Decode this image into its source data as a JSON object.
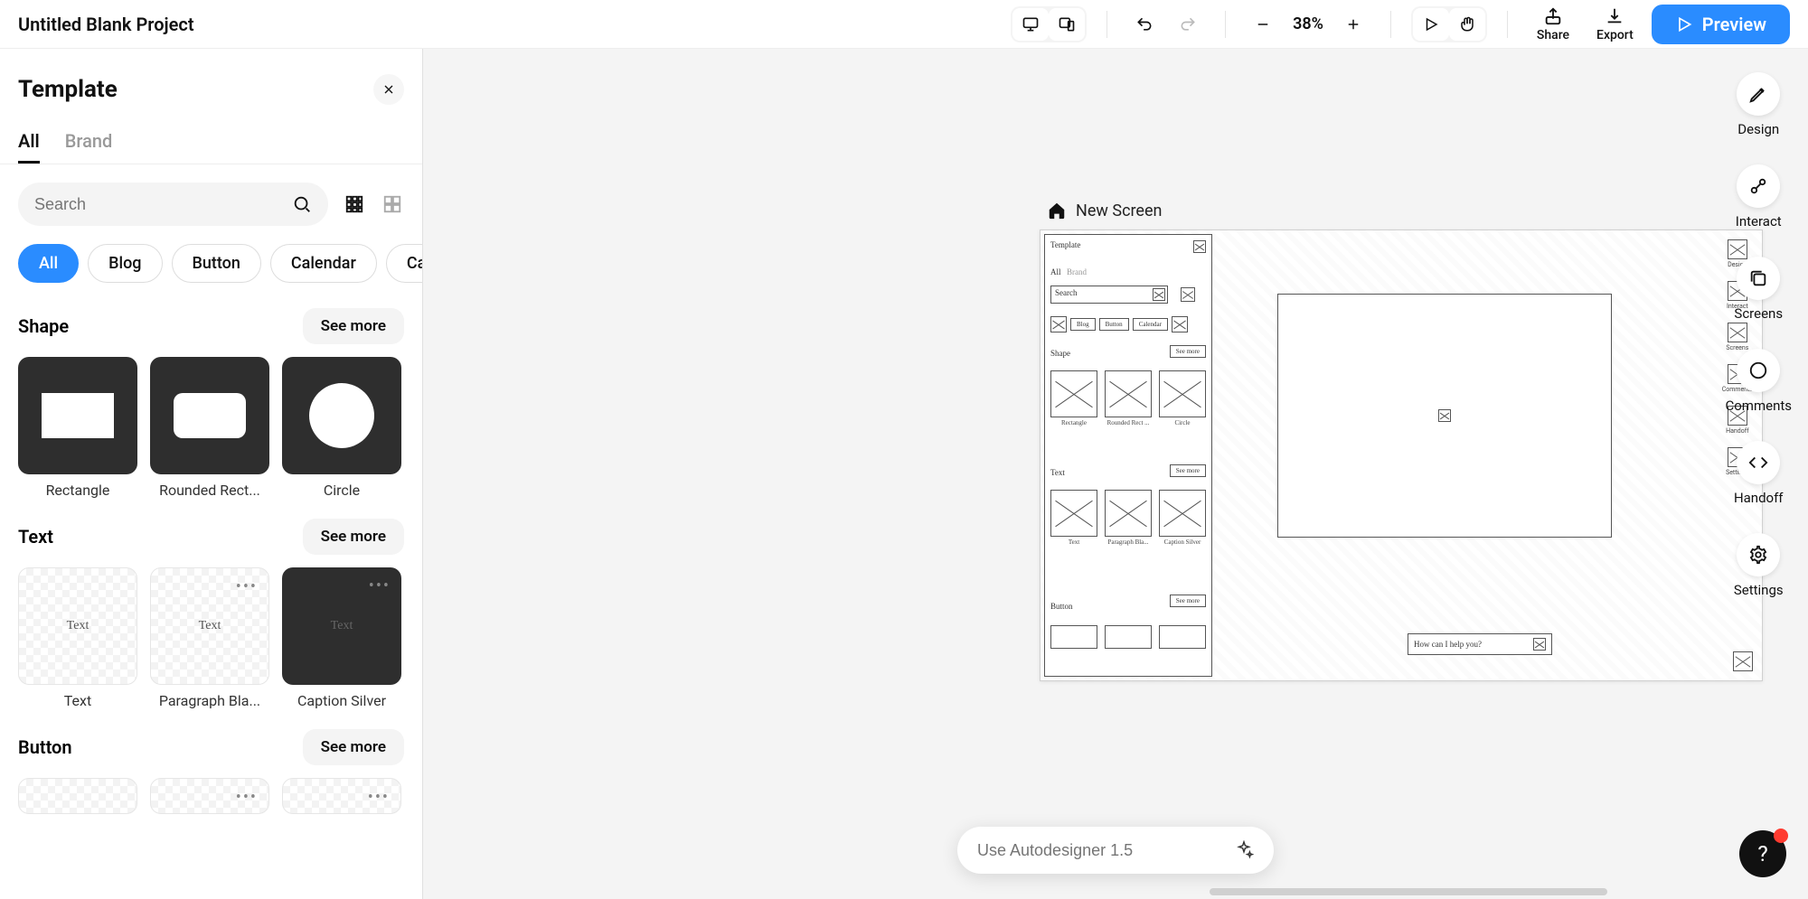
{
  "topbar": {
    "project_title": "Untitled Blank Project",
    "zoom": "38%",
    "share": "Share",
    "export": "Export",
    "preview": "Preview"
  },
  "panel": {
    "title": "Template",
    "tabs": {
      "all": "All",
      "brand": "Brand"
    },
    "search_placeholder": "Search",
    "chips": {
      "all": "All",
      "blog": "Blog",
      "button": "Button",
      "calendar": "Calendar",
      "more": "Ca"
    },
    "see_more": "See more",
    "sections": {
      "shape": {
        "title": "Shape",
        "items": [
          "Rectangle",
          "Rounded Rect...",
          "Circle"
        ]
      },
      "text": {
        "title": "Text",
        "items": [
          "Text",
          "Paragraph Bla...",
          "Caption Silver"
        ]
      },
      "button": {
        "title": "Button"
      }
    }
  },
  "canvas": {
    "screen_label": "New Screen",
    "wf": {
      "panel_title": "Template",
      "tab_a": "All",
      "tab_b": "Brand",
      "search": "Search",
      "chip_blog": "Blog",
      "chip_button": "Button",
      "chip_calendar": "Calendar",
      "section_shape": "Shape",
      "seemore": "See more",
      "item_rect": "Rectangle",
      "item_round": "Rounded Rect ...",
      "item_circle": "Circle",
      "section_text": "Text",
      "item_text": "Text",
      "item_para": "Paragraph Bla...",
      "item_caption": "Caption Silver",
      "section_button": "Button",
      "prompt": "How can I help you?",
      "r_design": "Design",
      "r_interact": "Interact",
      "r_screens": "Screens",
      "r_comments": "Comments",
      "r_handoff": "Handoff",
      "r_settings": "Settings"
    }
  },
  "ai_bar": {
    "placeholder": "Use Autodesigner 1.5"
  },
  "rail": {
    "design": "Design",
    "interact": "Interact",
    "screens": "Screens",
    "comments": "Comments",
    "handoff": "Handoff",
    "settings": "Settings"
  }
}
